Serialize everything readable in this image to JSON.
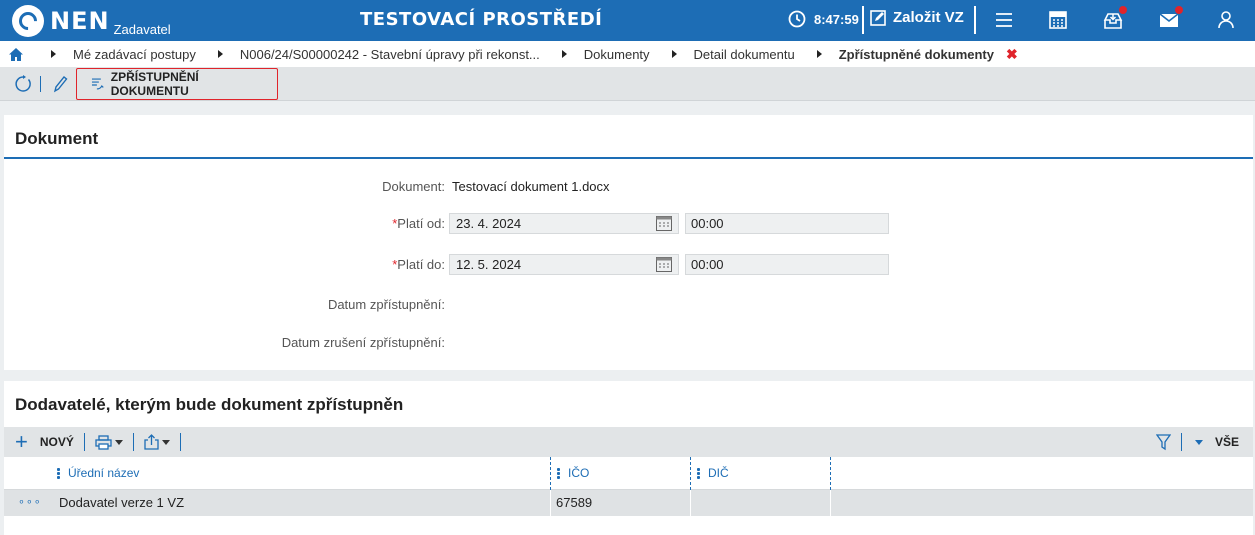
{
  "header": {
    "logo_text": "NEN",
    "logo_subtitle": "Zadavatel",
    "environment_title": "TESTOVACÍ PROSTŘEDÍ",
    "time": "8:47:59",
    "new_vz_label": "Založit VZ"
  },
  "breadcrumb": {
    "items": [
      "Mé zadávací postupy",
      "N006/24/S00000242 - Stavební úpravy při rekonst...",
      "Dokumenty",
      "Detail dokumentu"
    ],
    "current": "Zpřístupněné dokumenty"
  },
  "toolbar": {
    "access_button_label": "ZPŘÍSTUPNĚNÍ DOKUMENTU"
  },
  "dokument_section": {
    "title": "Dokument",
    "dokument_label": "Dokument:",
    "dokument_value": "Testovací dokument 1.docx",
    "plati_od_label": "Platí od:",
    "plati_od_date": "23. 4. 2024",
    "plati_od_time": "00:00",
    "plati_do_label": "Platí do:",
    "plati_do_date": "12. 5. 2024",
    "plati_do_time": "00:00",
    "datum_zpristupneni_label": "Datum zpřístupnění:",
    "datum_zruseni_label": "Datum zrušení zpřístupnění:"
  },
  "dodavatele_section": {
    "title": "Dodavatelé, kterým bude dokument zpřístupněn",
    "new_label": "NOVÝ",
    "filter_all_label": "VŠE",
    "columns": [
      "Úřední název",
      "IČO",
      "DIČ"
    ],
    "rows": [
      {
        "nazev": "Dodavatel verze 1 VZ",
        "ico": "67589",
        "dic": ""
      }
    ]
  },
  "colors": {
    "brand_blue": "#1d6db5",
    "alert_red": "#e0242b"
  }
}
